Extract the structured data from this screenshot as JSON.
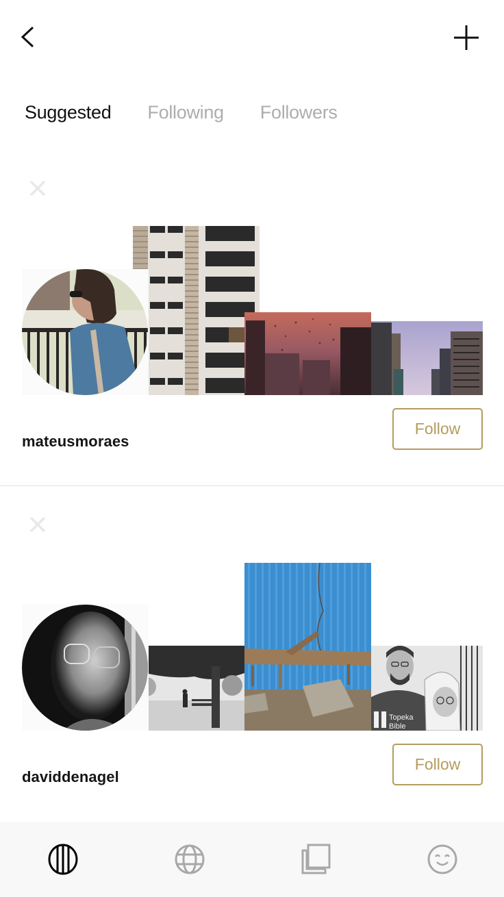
{
  "header": {
    "back_icon": "chevron-left-icon",
    "add_icon": "plus-icon"
  },
  "tabs": [
    {
      "label": "Suggested",
      "active": true
    },
    {
      "label": "Following",
      "active": false
    },
    {
      "label": "Followers",
      "active": false
    }
  ],
  "suggestions": [
    {
      "username": "mateusmoraes",
      "follow_label": "Follow",
      "dismiss_icon": "close-icon",
      "avatar_desc": "man with sunglasses and denim jacket in profile",
      "photos": [
        "tall beige apartment building facade",
        "rain-streaked window with pink sunset over city",
        "high-rise towers against lavender sky"
      ]
    },
    {
      "username": "daviddenagel",
      "follow_label": "Follow",
      "dismiss_icon": "close-icon",
      "avatar_desc": "black and white portrait of older man with glasses",
      "photos": [
        "black and white park with bench and tree in fog",
        "driftwood in front of blue corrugated wall",
        "black and white portrait of couple, shirt reading Topeka Bible"
      ],
      "photo_text": [
        "Topeka",
        "Bible"
      ]
    }
  ],
  "bottom_nav": [
    {
      "name": "feed",
      "icon": "striped-circle-icon",
      "active": true
    },
    {
      "name": "discover",
      "icon": "globe-icon",
      "active": false
    },
    {
      "name": "collections",
      "icon": "stacked-squares-icon",
      "active": false
    },
    {
      "name": "profile",
      "icon": "smiley-icon",
      "active": false
    }
  ],
  "colors": {
    "accent": "#b49c5c",
    "active_text": "#111111",
    "inactive_text": "#adadad",
    "nav_active": "#000000",
    "nav_inactive": "#a8a8a8",
    "nav_bg": "#f8f8f8",
    "divider": "#e3e3e3"
  }
}
